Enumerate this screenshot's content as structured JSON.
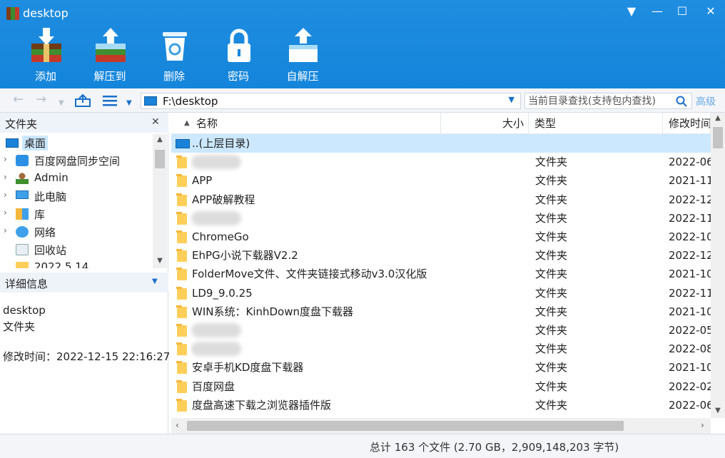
{
  "window": {
    "title": "desktop",
    "buttons": [
      "▼",
      "—",
      "☐",
      "✕"
    ]
  },
  "toolbar": {
    "add": "添加",
    "extract": "解压到",
    "delete": "删除",
    "password": "密码",
    "sfx": "自解压"
  },
  "address": {
    "path": "F:\\desktop",
    "search_placeholder": "当前目录查找(支持包内查找)",
    "advanced": "高级"
  },
  "folder_pane": {
    "title": "文件夹",
    "close": "✕",
    "items": [
      {
        "label": "桌面",
        "icon": "desktop-icon",
        "selected": true
      },
      {
        "label": "百度网盘同步空间",
        "icon": "cloud-sync-icon"
      },
      {
        "label": "Admin",
        "icon": "user-icon"
      },
      {
        "label": "此电脑",
        "icon": "computer-icon"
      },
      {
        "label": "库",
        "icon": "library-icon"
      },
      {
        "label": "网络",
        "icon": "network-icon"
      },
      {
        "label": "回收站",
        "icon": "recycle-bin-icon"
      },
      {
        "label": "2022.5.14",
        "icon": "folder-icon"
      }
    ]
  },
  "details_pane": {
    "title": "详细信息",
    "name": "desktop",
    "type": "文件夹",
    "modified": "修改时间：2022-12-15 22:16:27"
  },
  "columns": {
    "name": "名称",
    "size": "大小",
    "type": "类型",
    "modified": "修改时间"
  },
  "rows": [
    {
      "name": "..(上层目录)",
      "type": "",
      "date": "",
      "up": true
    },
    {
      "name": "",
      "type": "文件夹",
      "date": "2022-06",
      "blurred": true
    },
    {
      "name": "APP",
      "type": "文件夹",
      "date": "2021-11"
    },
    {
      "name": "APP破解教程",
      "type": "文件夹",
      "date": "2022-12"
    },
    {
      "name": "",
      "type": "文件夹",
      "date": "2022-11",
      "blurred": true
    },
    {
      "name": "ChromeGo",
      "type": "文件夹",
      "date": "2022-10"
    },
    {
      "name": "EhPG小说下载器V2.2",
      "type": "文件夹",
      "date": "2022-12"
    },
    {
      "name": "FolderMove文件、文件夹链接式移动v3.0汉化版",
      "type": "文件夹",
      "date": "2021-10"
    },
    {
      "name": "LD9_9.0.25",
      "type": "文件夹",
      "date": "2022-11"
    },
    {
      "name": "WIN系统：KinhDown度盘下载器",
      "type": "文件夹",
      "date": "2021-10"
    },
    {
      "name": "",
      "type": "文件夹",
      "date": "2022-05",
      "blurred": true
    },
    {
      "name": "",
      "type": "文件夹",
      "date": "2022-08",
      "blurred": true
    },
    {
      "name": "安卓手机KD度盘下载器",
      "type": "文件夹",
      "date": "2021-10"
    },
    {
      "name": "百度网盘",
      "type": "文件夹",
      "date": "2022-02"
    },
    {
      "name": "度盘高速下载之浏览器插件版",
      "type": "文件夹",
      "date": "2022-06"
    }
  ],
  "status": {
    "text": "总计 163 个文件 (2.70 GB，2,909,148,203 字节)"
  },
  "colors": {
    "accent": "#1485db",
    "selection": "#cce8ff",
    "folder": "#ffcf5a"
  }
}
